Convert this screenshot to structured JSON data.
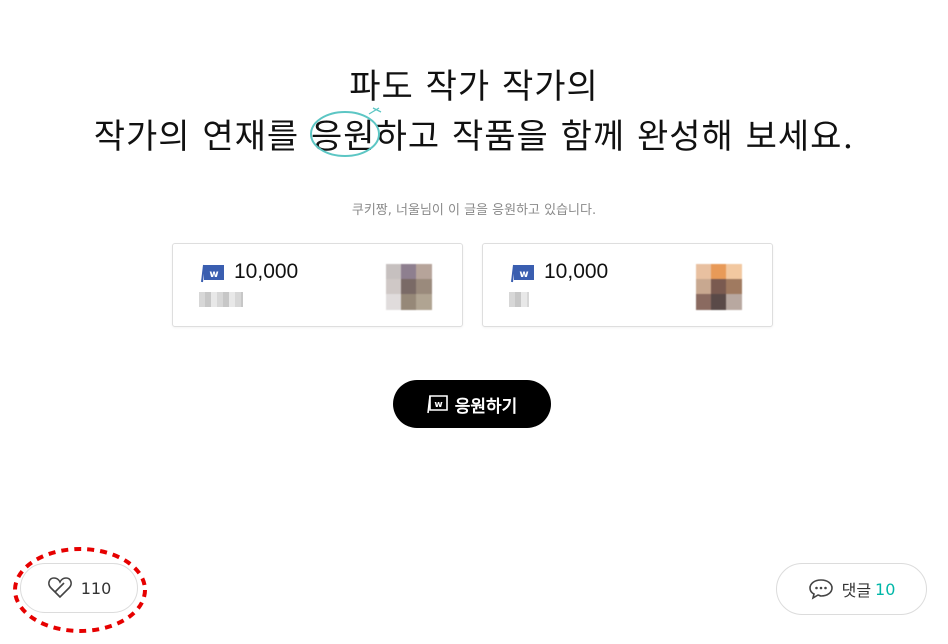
{
  "headline": {
    "line1": "파도 작가 작가의",
    "line2_before": "작가의 연재를 ",
    "line2_highlight": "응원",
    "line2_after": "하고 작품을 함께 완성해 보세요."
  },
  "supporters_caption": "쿠키짱, 너울님이 이 글을 응원하고 있습니다.",
  "support_cards": [
    {
      "amount": "10,000"
    },
    {
      "amount": "10,000"
    }
  ],
  "support_button": {
    "label": "응원하기"
  },
  "like": {
    "count": "110"
  },
  "comment": {
    "label": "댓글",
    "count": "10"
  },
  "colors": {
    "accent": "#00b7a8",
    "brand_coin": "#3a5eb0",
    "annotation": "#e60000",
    "highlight": "#5cc6c4"
  },
  "icons": [
    "coin-icon",
    "heart-icon",
    "speech-bubble-icon"
  ]
}
